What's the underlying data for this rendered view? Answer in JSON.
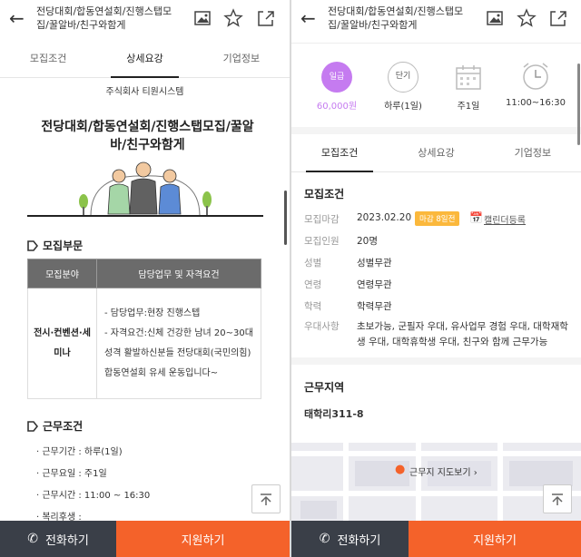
{
  "header": {
    "title": "전당대회/합동연설회/진행스탭모집/꿀알바/친구와함게"
  },
  "tabs": [
    "모집조건",
    "상세요강",
    "기업정보"
  ],
  "left": {
    "company": "주식회사 티원시스템",
    "poster_title": "전당대회/합동연설회/진행스탭모집/꿀알바/친구와함게",
    "recruit_section": "모집부문",
    "table_headers": [
      "모집분야",
      "담당업무 및 자격요건"
    ],
    "field": "전시·컨벤션·세미나",
    "duties": [
      "- 담당업무:현장 진행스텝",
      "- 자격요건:신체 건강한 남녀 20~30대 성격 활발하신분들 전당대회(국민의힘) 합동연설회 유세 운동입니다~"
    ],
    "work_section": "근무조건",
    "work_conditions": [
      "· 근무기간 : 하루(1일)",
      "· 근무요일 : 주1일",
      "· 근무시간 : 11:00 ~ 16:30",
      "· 복리후생 :"
    ]
  },
  "right": {
    "summary": [
      {
        "label": "60,000원",
        "badge": "일급",
        "icon": "wage-circle"
      },
      {
        "label": "하루(1일)",
        "badge": "단기",
        "icon": "term-circle"
      },
      {
        "label": "주1일",
        "icon": "calendar-icon"
      },
      {
        "label": "11:00~16:30",
        "icon": "clock-icon"
      }
    ],
    "recruit_title": "모집조건",
    "info": {
      "deadline_key": "모집마감",
      "deadline": "2023.02.20",
      "deadline_badge": "마감 8일전",
      "calendar_link": "캘린더등록",
      "headcount_key": "모집인원",
      "headcount": "20명",
      "gender_key": "성별",
      "gender": "성별무관",
      "age_key": "연령",
      "age": "연령무관",
      "edu_key": "학력",
      "edu": "학력무관",
      "pref_key": "우대사항",
      "pref": "초보가능, 군필자 우대, 유사업무 경험 우대, 대학재학생 우대, 대학휴학생 우대, 친구와 함께 근무가능"
    },
    "location_title": "근무지역",
    "address": "태학리311-8",
    "map_link": "근무지 지도보기"
  },
  "bottom": {
    "call": "전화하기",
    "apply": "지원하기"
  },
  "colors": {
    "accent": "#f4622a",
    "wage_purple": "#c57bf0",
    "badge_orange": "#fbb83c",
    "call_bg": "#3a3f48"
  }
}
